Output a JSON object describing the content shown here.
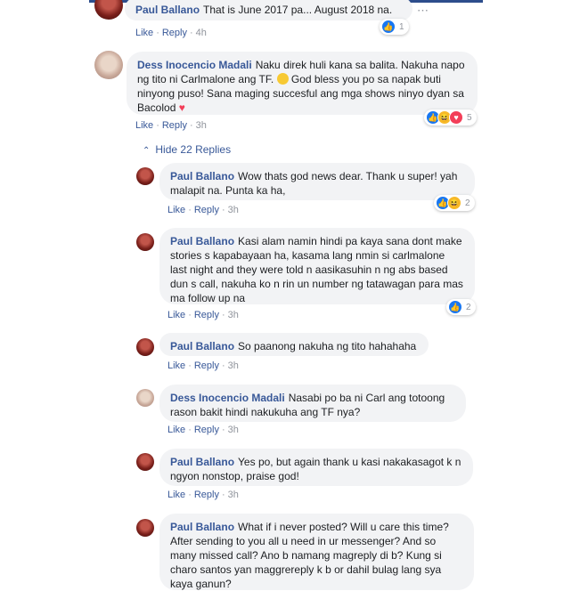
{
  "actions": {
    "like": "Like",
    "reply": "Reply",
    "dot": "·"
  },
  "comments": [
    {
      "author": "Paul Ballano",
      "text": "That is June 2017 pa... August 2018 na.",
      "time": "4h",
      "reaction_count": "1"
    },
    {
      "author": "Dess Inocencio Madali",
      "text_a": "Naku direk huli kana sa balita. Nakuha napo ng tito ni Carlmalone ang TF. ",
      "text_b": " God bless you po sa napak buti ninyong puso! Sana maging succesful ang mga shows ninyo dyan sa Bacolod ",
      "heart": "♥",
      "time": "3h",
      "reaction_count": "5"
    }
  ],
  "hide_replies": "Hide 22 Replies",
  "replies": [
    {
      "author": "Paul Ballano",
      "text": "Wow thats god news dear. Thank u super! yah malapit na. Punta ka ha,",
      "time": "3h",
      "reaction_count": "2"
    },
    {
      "author": "Paul Ballano",
      "text": "Kasi alam namin hindi pa kaya sana dont make stories s kapabayaan ha, kasama lang nmin si carlmalone last night and they were told n aasikasuhin n ng abs based dun s call, nakuha ko n rin un number ng tatawagan para mas ma follow up na",
      "time": "3h",
      "reaction_count": "2"
    },
    {
      "author": "Paul Ballano",
      "text": "So paanong nakuha ng tito hahahaha",
      "time": "3h"
    },
    {
      "author": "Dess Inocencio Madali",
      "text": "Nasabi po ba ni Carl ang totoong rason bakit hindi nakukuha ang TF nya?",
      "time": "3h"
    },
    {
      "author": "Paul Ballano",
      "text": "Yes po, but again thank u kasi nakakasagot k n ngyon nonstop, praise god!",
      "time": "3h"
    },
    {
      "author": "Paul Ballano",
      "text": "What if i never posted? Will u care this time? After sending to you all u need in ur messenger? And so many missed call? Ano b namang magreply di b? Kung si charo santos yan maggrereply k b or dahil bulag lang sya kaya ganun?"
    }
  ],
  "colors": {
    "link": "#385898",
    "bubble": "#f2f3f5",
    "like": "#1877f2",
    "haha": "#f7b928",
    "love": "#f33e58"
  }
}
